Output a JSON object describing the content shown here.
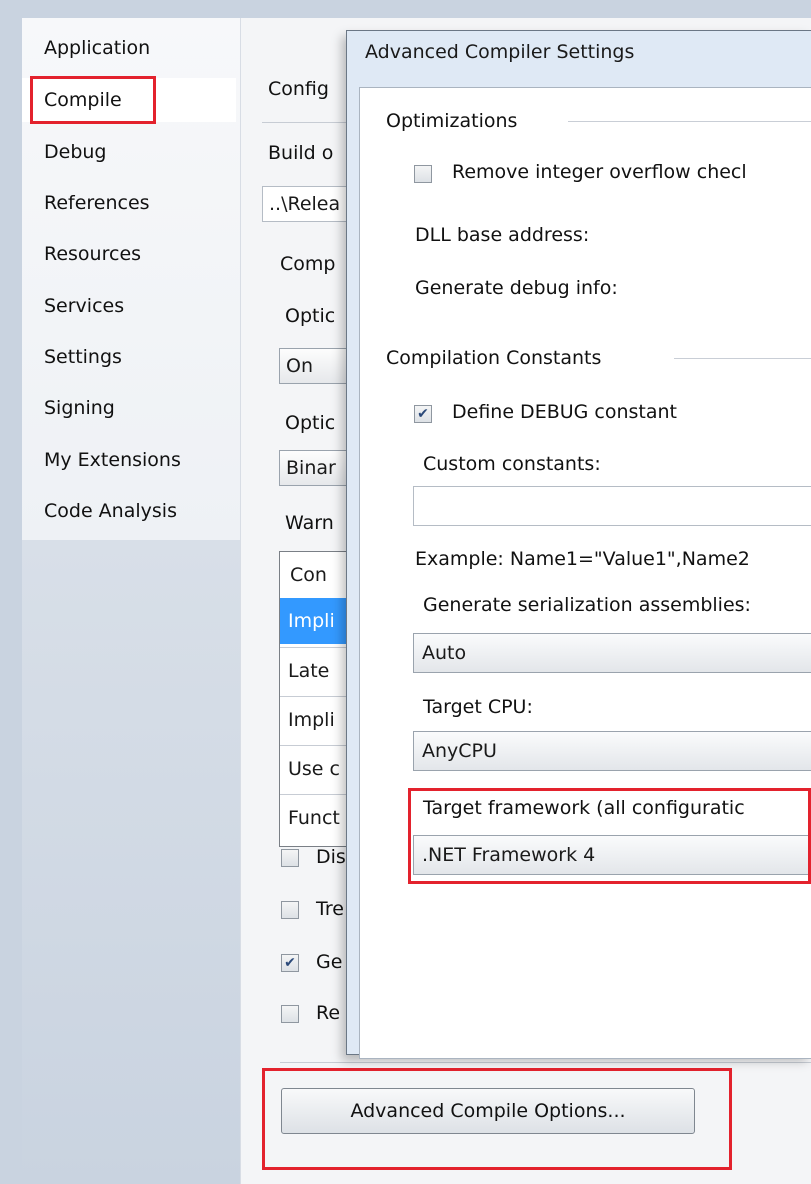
{
  "sidebar": {
    "items": [
      {
        "label": "Application"
      },
      {
        "label": "Compile"
      },
      {
        "label": "Debug"
      },
      {
        "label": "References"
      },
      {
        "label": "Resources"
      },
      {
        "label": "Services"
      },
      {
        "label": "Settings"
      },
      {
        "label": "Signing"
      },
      {
        "label": "My Extensions"
      },
      {
        "label": "Code Analysis"
      }
    ],
    "selected": "Compile"
  },
  "main": {
    "configuration_label": "Config",
    "build_output_label": "Build o",
    "build_output_value": "..\\Relea",
    "compile_options_label": "Comp",
    "option1_label": "Optic",
    "option1_value": "On",
    "option2_label": "Optic",
    "option2_value": "Binar",
    "warnings_label": "Warn",
    "grid": {
      "header": "Con",
      "rows": [
        "Impli",
        "Late",
        "Impli",
        "Use c",
        "Funct"
      ]
    },
    "checkboxes": [
      {
        "label": "Dis",
        "checked": false
      },
      {
        "label": "Tre",
        "checked": false
      },
      {
        "label": "Ge",
        "checked": true
      },
      {
        "label": "Re",
        "checked": false
      }
    ],
    "advanced_button_label": "Advanced Compile Options..."
  },
  "dialog": {
    "title": "Advanced Compiler Settings",
    "optimizations_header": "Optimizations",
    "remove_overflow_label": "Remove integer overflow checl",
    "remove_overflow_checked": false,
    "dll_base_label": "DLL base address:",
    "debug_info_label": "Generate debug info:",
    "constants_header": "Compilation Constants",
    "define_debug_label": "Define DEBUG constant",
    "define_debug_checked": true,
    "custom_constants_label": "Custom constants:",
    "custom_constants_value": "",
    "example_text": "Example: Name1=\"Value1\",Name2",
    "serialization_label": "Generate serialization assemblies:",
    "serialization_value": "Auto",
    "target_cpu_label": "Target CPU:",
    "target_cpu_value": "AnyCPU",
    "target_framework_label": "Target framework (all configuratic",
    "target_framework_value": ".NET Framework 4"
  },
  "colors": {
    "highlight": "#e3222d",
    "selection": "#3399ff"
  }
}
